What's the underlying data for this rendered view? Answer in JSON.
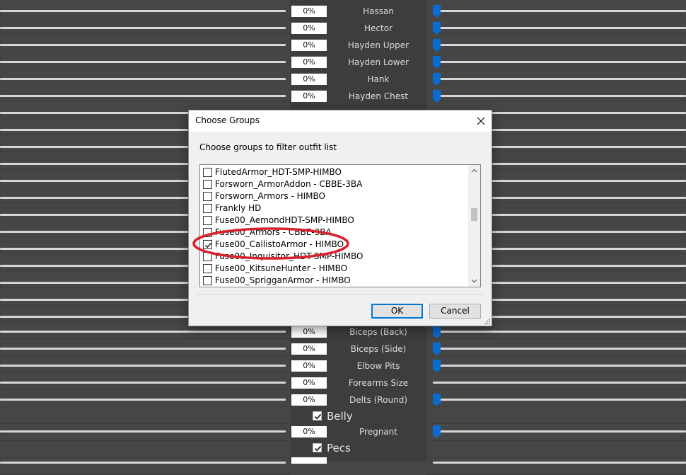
{
  "sliders_top": [
    {
      "value": "0%",
      "label": "Hassan",
      "thumb": true
    },
    {
      "value": "0%",
      "label": "Hector",
      "thumb": true
    },
    {
      "value": "0%",
      "label": "Hayden Upper",
      "thumb": true
    },
    {
      "value": "0%",
      "label": "Hayden Lower",
      "thumb": true
    },
    {
      "value": "0%",
      "label": "Hank",
      "thumb": true
    },
    {
      "value": "0%",
      "label": "Hayden Chest",
      "thumb": true
    }
  ],
  "sliders_bottom": [
    {
      "value": "0%",
      "label": "Biceps (Back)",
      "thumb": true
    },
    {
      "value": "0%",
      "label": "Biceps (Side)",
      "thumb": true
    },
    {
      "value": "0%",
      "label": "Elbow Pits",
      "thumb": true
    },
    {
      "value": "0%",
      "label": "Forearms Size",
      "thumb": false
    },
    {
      "value": "0%",
      "label": "Delts (Round)",
      "thumb": true
    }
  ],
  "section_belly": {
    "label": "Belly",
    "checked": true
  },
  "slider_pregnant": {
    "value": "0%",
    "label": "Pregnant",
    "thumb": true
  },
  "section_pecs": {
    "label": "Pecs",
    "checked": true
  },
  "dialog": {
    "title": "Choose Groups",
    "instruction": "Choose groups to filter outfit list",
    "items": [
      {
        "label": "FlutedArmor_HDT-SMP-HIMBO",
        "checked": false
      },
      {
        "label": "Forsworn_ArmorAddon - CBBE-3BA",
        "checked": false
      },
      {
        "label": "Forsworn_Armors - HIMBO",
        "checked": false
      },
      {
        "label": "Frankly HD",
        "checked": false
      },
      {
        "label": "Fuse00_AemondHDT-SMP-HIMBO",
        "checked": false
      },
      {
        "label": "Fuse00_Armors - CBBE-3BA",
        "checked": false
      },
      {
        "label": "Fuse00_CallistoArmor - HIMBO",
        "checked": true
      },
      {
        "label": "Fuse00_Inquisitor_HDT-SMP-HIMBO",
        "checked": false
      },
      {
        "label": "Fuse00_KitsuneHunter - HIMBO",
        "checked": false
      },
      {
        "label": "Fuse00_SprigganArmor - HIMBO",
        "checked": false
      }
    ],
    "ok_label": "OK",
    "cancel_label": "Cancel"
  },
  "colors": {
    "accent": "#0a6bd1",
    "highlight": "#d9212a",
    "panel": "#464646"
  }
}
